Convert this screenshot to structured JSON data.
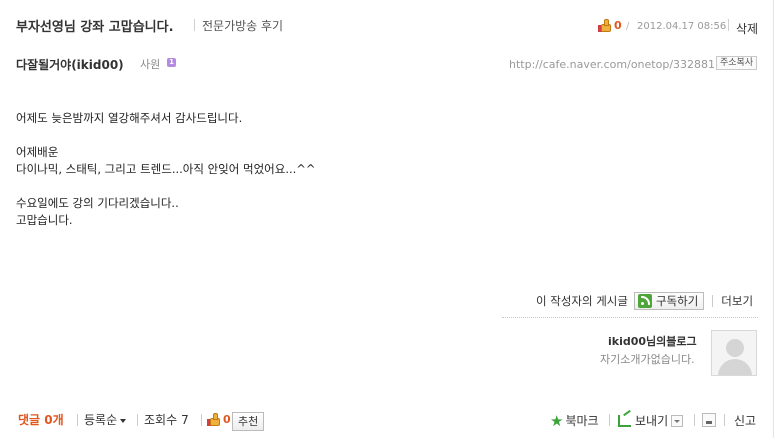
{
  "post": {
    "title": "부자선영님 강좌 고맙습니다.",
    "category": "전문가방송 후기",
    "likes": "0",
    "date": "2012.04.17 08:56",
    "delete_label": "삭제"
  },
  "author": {
    "name": "다잘될거야(ikid00)",
    "rank": "사원",
    "rank_badge": "1",
    "url": "http://cafe.naver.com/onetop/332881",
    "copy_address_label": "주소복사"
  },
  "content": {
    "lines": [
      "어제도 늦은밤까지 열강해주셔서 감사드립니다.",
      "",
      "어제배운",
      "다이나믹, 스태틱, 그리고 트렌드...아직 안잊어 먹었어요...^^",
      "",
      "수요일에도 강의 기다리겠습니다..",
      "고맙습니다."
    ]
  },
  "writer_posts": {
    "label": "이 작성자의 게시글",
    "subscribe_label": "구독하기",
    "more_label": "더보기"
  },
  "blog": {
    "name": "ikid00님의블로그",
    "intro": "자기소개가없습니다."
  },
  "footer": {
    "comment_label": "댓글",
    "comment_count": "0개",
    "sort_label": "등록순",
    "views_label": "조회수",
    "views_count": "7",
    "likes": "0",
    "recommend_label": "추천",
    "bookmark_label": "북마크",
    "send_label": "보내기",
    "report_label": "신고"
  },
  "colors": {
    "accent_orange": "#e0561e",
    "accent_green": "#3aa43a"
  }
}
